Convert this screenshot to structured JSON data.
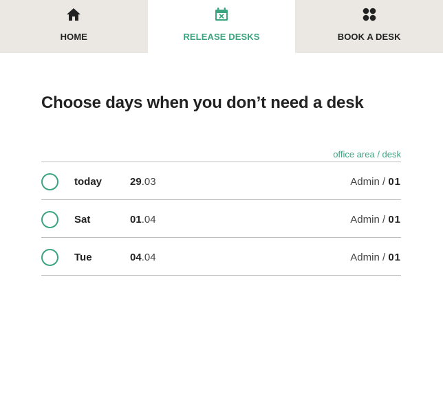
{
  "tabs": [
    {
      "label": "HOME",
      "icon": "home-icon",
      "active": false
    },
    {
      "label": "RELEASE DESKS",
      "icon": "calendar-x-icon",
      "active": true
    },
    {
      "label": "BOOK A DESK",
      "icon": "grid-dots-icon",
      "active": false
    }
  ],
  "page": {
    "title": "Choose days when you don’t need a desk",
    "column_header": "office area / desk"
  },
  "rows": [
    {
      "day": "today",
      "date_day": "29",
      "date_month": ".03",
      "area": "Admin",
      "separator": " / ",
      "desk": "01"
    },
    {
      "day": "Sat",
      "date_day": "01",
      "date_month": ".04",
      "area": "Admin",
      "separator": " / ",
      "desk": "01"
    },
    {
      "day": "Tue",
      "date_day": "04",
      "date_month": ".04",
      "area": "Admin",
      "separator": " / ",
      "desk": "01"
    }
  ],
  "colors": {
    "accent": "#3aa57f",
    "tab_bg": "#ebe8e3",
    "text": "#222222",
    "divider": "#bdbdbd"
  }
}
